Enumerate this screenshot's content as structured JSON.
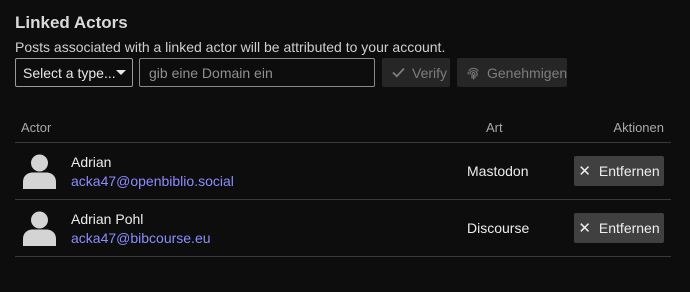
{
  "section": {
    "title": "Linked Actors",
    "description": "Posts associated with a linked actor will be attributed to your account."
  },
  "form": {
    "type_select": {
      "selected": "Select a type..."
    },
    "domain_input": {
      "value": "",
      "placeholder": "gib eine Domain ein"
    },
    "verify_label": "Verify",
    "approve_label": "Genehmigen"
  },
  "table": {
    "headers": {
      "actor": "Actor",
      "type": "Art",
      "actions": "Aktionen"
    },
    "rows": [
      {
        "name": "Adrian",
        "handle": "acka47@openbiblio.social",
        "type": "Mastodon",
        "action": "Entfernen"
      },
      {
        "name": "Adrian Pohl",
        "handle": "acka47@bibcourse.eu",
        "type": "Discourse",
        "action": "Entfernen"
      }
    ]
  },
  "icons": {
    "verify": "check-icon",
    "approve": "fingerprint-icon",
    "remove": "close-icon",
    "avatar": "user-icon",
    "select": "caret-down-icon"
  },
  "colors": {
    "background": "#0d0d0d",
    "link": "#8c8cff",
    "remove_button": "#404040",
    "disabled_button": "#262626"
  }
}
